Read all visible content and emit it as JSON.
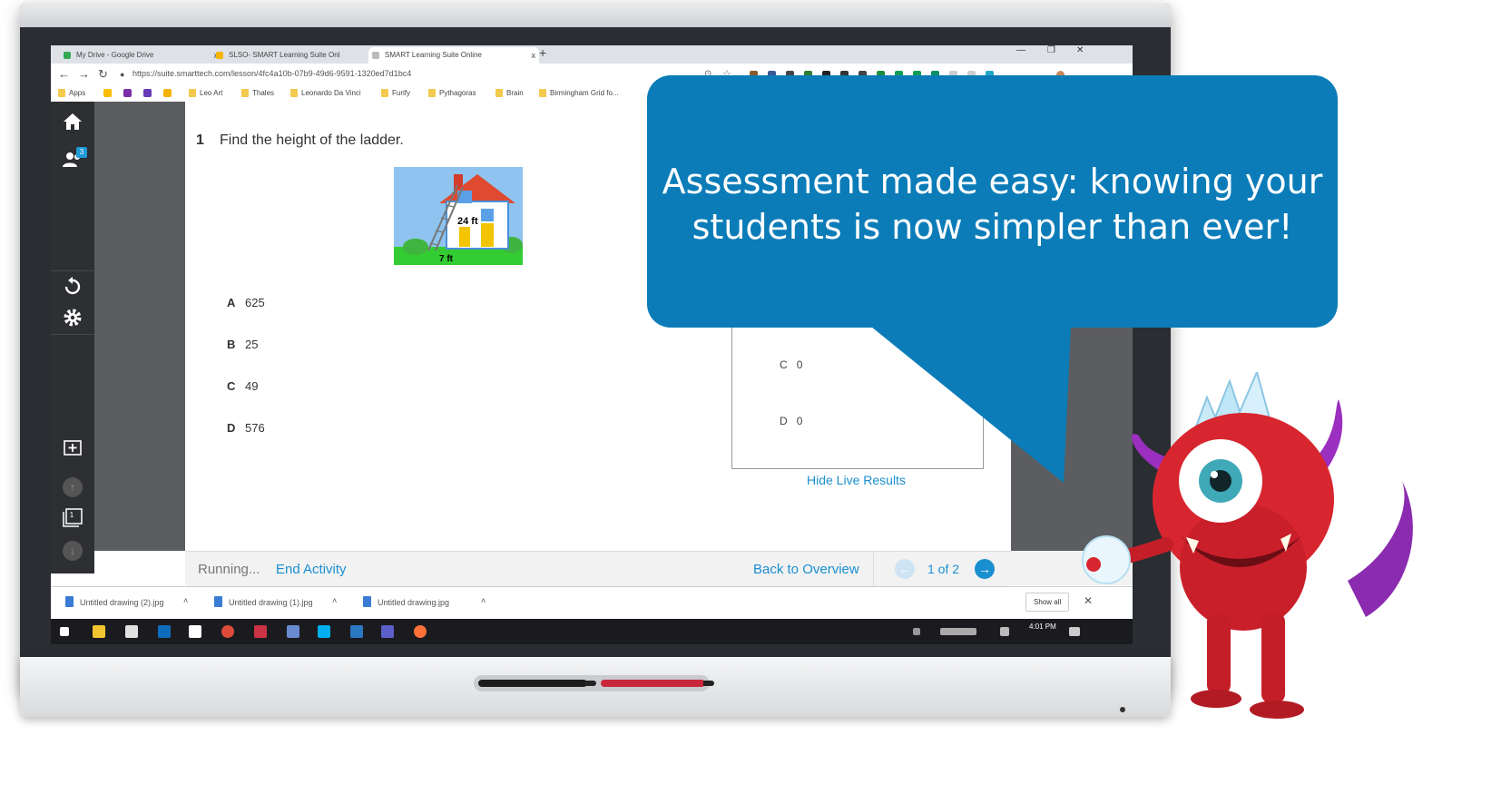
{
  "browser": {
    "tabs": [
      {
        "label": "My Drive - Google Drive",
        "close": "x"
      },
      {
        "label": "SLSO- SMART Learning Suite Onl",
        "close": "x"
      },
      {
        "label": "SMART Learning Suite Online",
        "close": "x"
      }
    ],
    "new_tab": "+",
    "url": "https://suite.smarttech.com/lesson/4fc4a10b-07b9-49d6-9591-1320ed7d1bc4",
    "bookmarks": [
      "Apps",
      "Leo Art",
      "Thales",
      "Leonardo Da Vinci",
      "Furify",
      "Pythagoras",
      "Brain",
      "Birmingham Grid fo..."
    ]
  },
  "sidebar": {
    "participants_badge": "3",
    "page_badge": "1"
  },
  "question": {
    "number": "1",
    "text": "Find the height of the ladder.",
    "image_labels": {
      "height": "24 ft",
      "base": "7 ft"
    },
    "choices": [
      {
        "letter": "A",
        "value": "625"
      },
      {
        "letter": "B",
        "value": "25"
      },
      {
        "letter": "C",
        "value": "49"
      },
      {
        "letter": "D",
        "value": "576"
      }
    ]
  },
  "results": {
    "rows": [
      {
        "letter": "C",
        "count": "0"
      },
      {
        "letter": "D",
        "count": "0"
      }
    ],
    "hide_link": "Hide Live Results"
  },
  "footer": {
    "status": "Running...",
    "end_activity": "End Activity",
    "back_to_overview": "Back to Overview",
    "page_indicator": "1 of 2"
  },
  "downloads": {
    "items": [
      "Untitled drawing (2).jpg",
      "Untitled drawing (1).jpg",
      "Untitled drawing.jpg"
    ],
    "show_all": "Show all",
    "close": "✕"
  },
  "taskbar": {
    "time": "4:01 PM"
  },
  "callout": {
    "line1": "Assessment made easy: knowing your",
    "line2": "students is now simpler than ever!"
  },
  "colors": {
    "callout": "#0b7cb8",
    "link": "#1a8fd0",
    "sidebar": "#2d2f33",
    "results_bar": "#e24a1b"
  }
}
